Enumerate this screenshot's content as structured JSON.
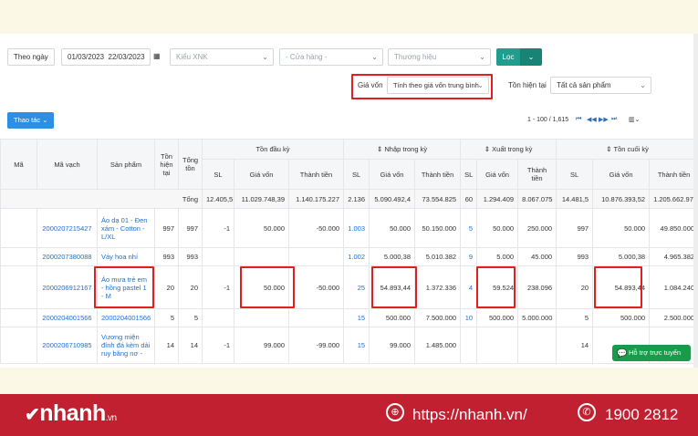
{
  "filters": {
    "period": "Theo ngày",
    "date_from": "01/03/2023",
    "date_to": "22/03/2023",
    "xnk": "Kiểu XNK",
    "store": "- Cửa hàng -",
    "brand": "Thương hiệu",
    "filter_button": "Lọc",
    "cost_label": "Giá vốn",
    "cost_value": "Tính theo giá vốn trung bình",
    "stock_label": "Tồn hiện tại",
    "stock_value": "Tất cả sản phẩm"
  },
  "toolbar": {
    "action": "Thao tác",
    "pager": "1 - 100 / 1,615"
  },
  "headers": {
    "ma": "Mã",
    "ma_vach": "Mã vạch",
    "san_pham": "Sản phẩm",
    "ton_hien_tai": "Tồn hiện tại",
    "tong_ton": "Tổng tồn",
    "g1": "Tồn đầu kỳ",
    "g2": "⇕ Nhập trong kỳ",
    "g3": "⇕ Xuất trong kỳ",
    "g4": "⇕ Tồn cuối kỳ",
    "sl": "SL",
    "gia_von": "Giá vốn",
    "thanh_tien": "Thành tiền"
  },
  "totals": [
    "Tổng",
    "12.405,5",
    "11.029.748,39",
    "1.140.175.227",
    "2.136",
    "5.090.492,4",
    "73.554.825",
    "60",
    "1.294.409",
    "8.067.075",
    "14.481,5",
    "10.876.393,52",
    "1.205.662.977"
  ],
  "rows": [
    {
      "mv": "2000207215427",
      "sp": "Áo dạ 01 - Đen xám - Cotton - L/XL",
      "th": "997",
      "tt": "997",
      "c": [
        "-1",
        "50.000",
        "-50.000",
        "1.003",
        "50.000",
        "50.150.000",
        "5",
        "50.000",
        "250.000",
        "997",
        "50.000",
        "49.850.000"
      ]
    },
    {
      "mv": "2000207380088",
      "sp": "Váy hoa nhí",
      "th": "993",
      "tt": "993",
      "c": [
        "",
        "",
        "",
        "1.002",
        "5.000,38",
        "5.010.382",
        "9",
        "5.000",
        "45.000",
        "993",
        "5.000,38",
        "4.965.382"
      ]
    },
    {
      "mv": "2000206912167",
      "sp": "Áo mưa trẻ em - hồng pastel 1 - M",
      "th": "20",
      "tt": "20",
      "c": [
        "-1",
        "50.000",
        "-50.000",
        "25",
        "54.893,44",
        "1.372.336",
        "4",
        "59.524",
        "238.096",
        "20",
        "54.893,44",
        "1.084.240"
      ]
    },
    {
      "mv": "2000204001566",
      "sp": "2000204001566",
      "th": "5",
      "tt": "5",
      "c": [
        "",
        "",
        "",
        "15",
        "500.000",
        "7.500.000",
        "10",
        "500.000",
        "5.000.000",
        "5",
        "500.000",
        "2.500.000"
      ]
    },
    {
      "mv": "2000206710985",
      "sp": "Vương miện đính đá kèm dải ruy băng nơ -",
      "th": "14",
      "tt": "14",
      "c": [
        "-1",
        "99.000",
        "-99.000",
        "15",
        "99.000",
        "1.485.000",
        "",
        "",
        "",
        "14",
        "",
        ""
      ]
    }
  ],
  "support": "Hỗ trợ trực tuyến",
  "footer": {
    "brand": "nhanh",
    "brand_suffix": ".vn",
    "url": "https://nhanh.vn/",
    "phone": "1900 2812"
  }
}
